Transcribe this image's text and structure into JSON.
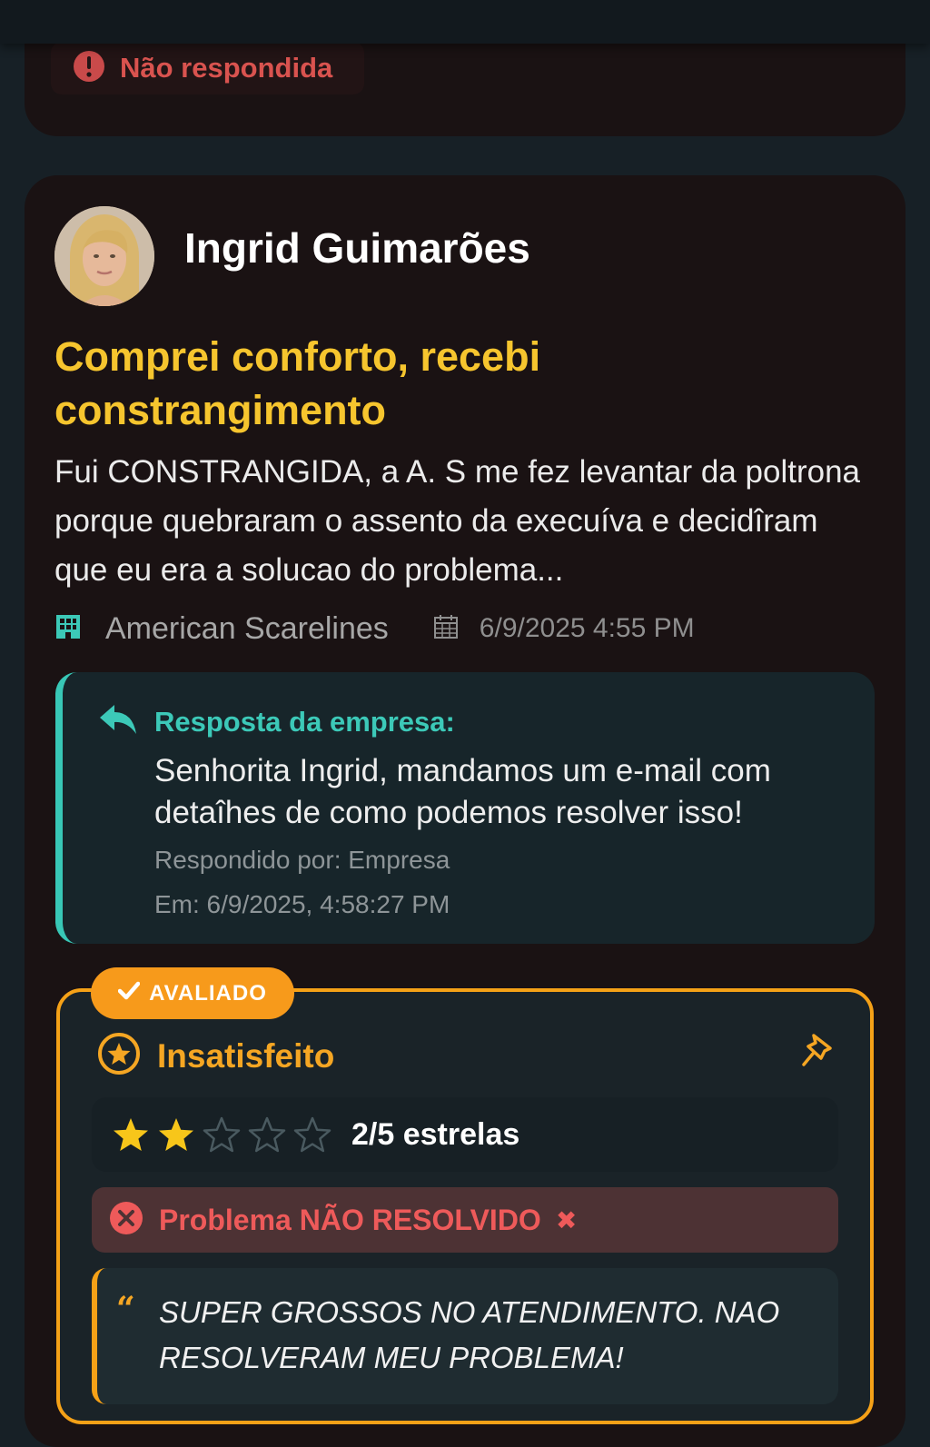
{
  "previous_card": {
    "status_label": "Não respondida"
  },
  "review": {
    "author_name": "Ingrid Guimarões",
    "title": "Comprei conforto, recebi constrangimento",
    "body": "Fui CONSTRANGIDA, a A. S me fez levantar da poltrona porque quebraram o assento da execuíva e decidîram que eu era a solucao do problema...",
    "company": "American Scarelines",
    "date": "6/9/2025 4:55 PM"
  },
  "company_reply": {
    "label": "Resposta da empresa:",
    "text": "Senhorita Ingrid, mandamos um e-mail com detaîhes de como podemos resolver isso!",
    "responded_by": "Respondido por: Empresa",
    "responded_at": "Em: 6/9/2025, 4:58:27 PM"
  },
  "evaluation": {
    "badge": "AVALIADO",
    "satisfaction": "Insatisfeito",
    "rating": 2,
    "rating_max": 5,
    "rating_label": "2/5 estrelas",
    "problem_status": "Problema NÃO RESOLVIDO",
    "problem_mark": "✖",
    "comment": "SUPER GROSSOS NO ATENDIMENTO. NAO RESOLVERAM MEU PROBLEMA!",
    "quote_mark": "“"
  },
  "colors": {
    "accent_title": "#f6c52e",
    "reply_accent": "#38c7b6",
    "eval_accent": "#f5a117",
    "problem_red": "#ee5a5a",
    "unanswered_red": "#d9534f",
    "star_filled": "#f7c61a",
    "star_empty": "#4a5a60"
  },
  "icons": {
    "unanswered": "exclamation-circle-icon",
    "company": "building-icon",
    "date": "calendar-icon",
    "reply": "reply-arrow-icon",
    "badge": "check-icon",
    "satisfaction": "star-circle-icon",
    "pin": "pin-icon",
    "problem": "x-circle-icon"
  }
}
